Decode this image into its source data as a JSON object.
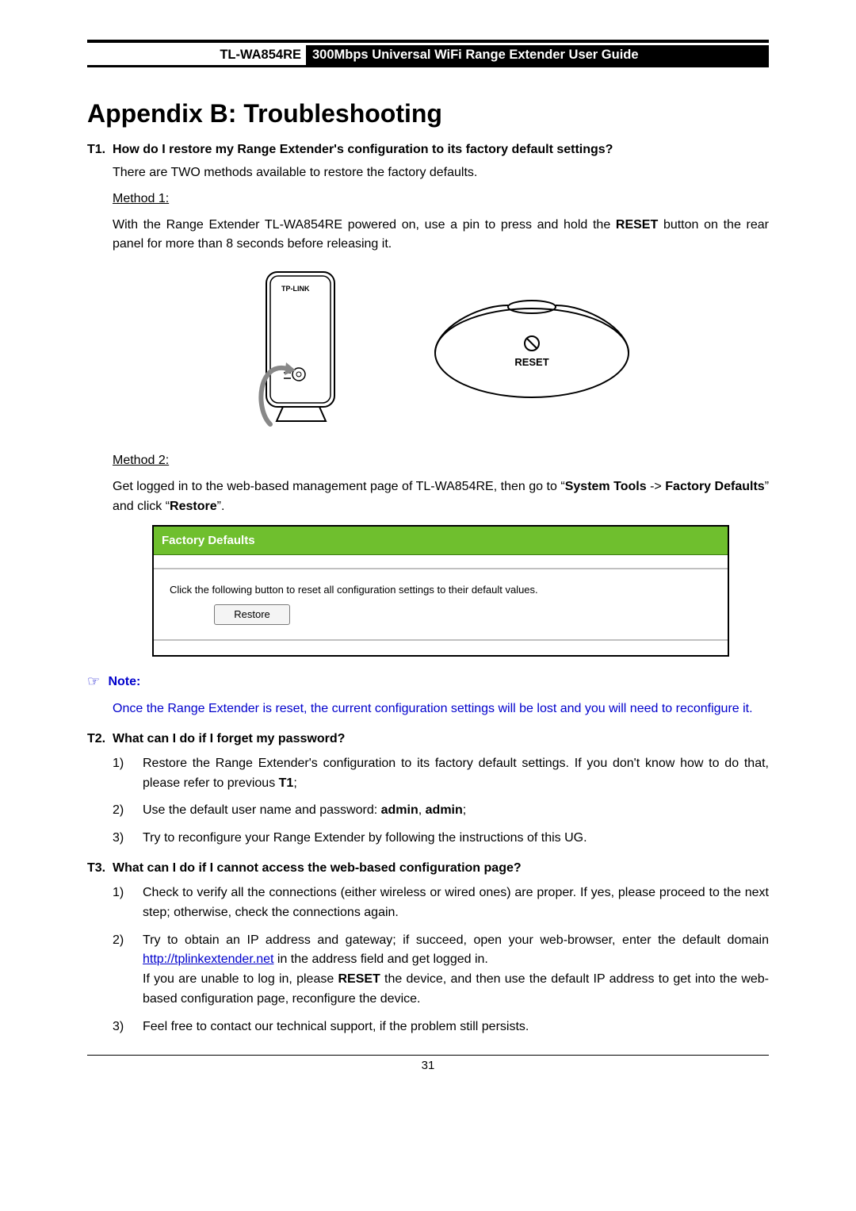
{
  "header": {
    "model": "TL-WA854RE",
    "title": "300Mbps Universal WiFi Range Extender User Guide"
  },
  "heading": "Appendix B: Troubleshooting",
  "t1": {
    "num": "T1.",
    "question": "How do I restore my Range Extender's configuration to its factory default settings?",
    "intro": "There are TWO methods available to restore the factory defaults.",
    "method1_label": "Method 1:",
    "method1_text_a": "With the Range Extender TL-WA854RE powered on, use a pin to press and hold the ",
    "method1_reset": "RESET",
    "method1_text_b": " button on the rear panel for more than 8 seconds before releasing it.",
    "method2_label": "Method 2:",
    "method2_a": "Get logged in to the web-based management page of TL-WA854RE, then go to “",
    "method2_system_tools": "System Tools",
    "method2_arrow": " -> ",
    "method2_factory_defaults": "Factory Defaults",
    "method2_b": "” and click “",
    "method2_restore": "Restore",
    "method2_c": "”."
  },
  "figure": {
    "device_logo": "TP-LINK",
    "reset_label": "RESET"
  },
  "panel": {
    "title": "Factory Defaults",
    "body": "Click the following button to reset all configuration settings to their default values.",
    "button": "Restore"
  },
  "note": {
    "label": "Note:",
    "text": "Once the Range Extender is reset, the current configuration settings will be lost and you will need to reconfigure it."
  },
  "t2": {
    "num": "T2.",
    "question": "What can I do if I forget my password?",
    "items": [
      {
        "n": "1)",
        "pre": "Restore the Range Extender's configuration to its factory default settings. If you don't know how to do that, please refer to previous ",
        "bold": "T1",
        "post": ";"
      },
      {
        "n": "2)",
        "pre": "Use the default user name and password: ",
        "bold": "admin",
        "sep": ", ",
        "bold2": "admin",
        "post": ";"
      },
      {
        "n": "3)",
        "pre": "Try to reconfigure your Range Extender by following the instructions of this UG.",
        "bold": "",
        "post": ""
      }
    ]
  },
  "t3": {
    "num": "T3.",
    "question": "What can I do if I cannot access the web-based configuration page?",
    "items": [
      {
        "n": "1)",
        "text": "Check to verify all the connections (either wireless or wired ones) are proper. If yes, please proceed to the next step; otherwise, check the connections again."
      },
      {
        "n": "2)",
        "a": "Try to obtain an IP address and gateway; if succeed, open your web-browser, enter the default domain ",
        "link": "http://tplinkextender.net",
        "b": " in the address field and get logged in.",
        "c": "If you are unable to log in, please ",
        "resetb": "RESET",
        "d": " the device, and then use the default IP address to get into the web-based configuration page, reconfigure the device."
      },
      {
        "n": "3)",
        "text": "Feel free to contact our technical support, if the problem still persists."
      }
    ]
  },
  "page_number": "31"
}
